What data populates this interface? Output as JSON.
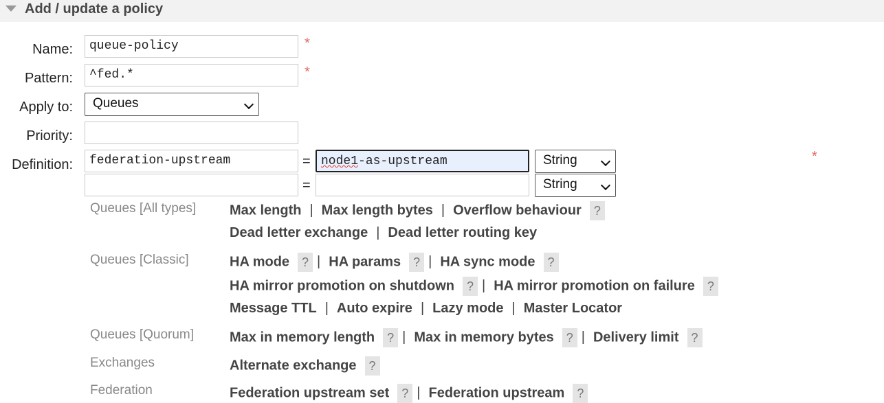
{
  "section": {
    "title": "Add / update a policy"
  },
  "form": {
    "name_label": "Name:",
    "name_value": "queue-policy",
    "pattern_label": "Pattern:",
    "pattern_value": "^fed.*",
    "apply_label": "Apply to:",
    "apply_value": "Queues",
    "priority_label": "Priority:",
    "priority_value": "",
    "definition_label": "Definition:",
    "required_mark": "*",
    "definitions": [
      {
        "key": "federation-upstream",
        "value_prefix": "",
        "value_misspelled": "node1",
        "value_suffix": "-as-upstream",
        "type": "String"
      },
      {
        "key": "",
        "value": "",
        "type": "String"
      }
    ],
    "equals": "="
  },
  "categories": [
    {
      "label": "Queues [All types]",
      "rows": [
        [
          "Max length",
          "Max length bytes",
          "Overflow behaviour"
        ],
        [
          "Dead letter exchange",
          "Dead letter routing key"
        ]
      ]
    },
    {
      "label": "Queues [Classic]",
      "rows": [
        [
          "HA mode",
          "HA params",
          "HA sync mode"
        ],
        [
          "HA mirror promotion on shutdown",
          "HA mirror promotion on failure"
        ],
        [
          "Message TTL",
          "Auto expire",
          "Lazy mode",
          "Master Locator"
        ]
      ]
    },
    {
      "label": "Queues [Quorum]",
      "rows": [
        [
          "Max in memory length",
          "Max in memory bytes",
          "Delivery limit"
        ]
      ]
    },
    {
      "label": "Exchanges",
      "rows": [
        [
          "Alternate exchange"
        ]
      ]
    },
    {
      "label": "Federation",
      "rows": [
        [
          "Federation upstream set",
          "Federation upstream"
        ]
      ]
    }
  ],
  "help_mark": "?",
  "separator": "|"
}
